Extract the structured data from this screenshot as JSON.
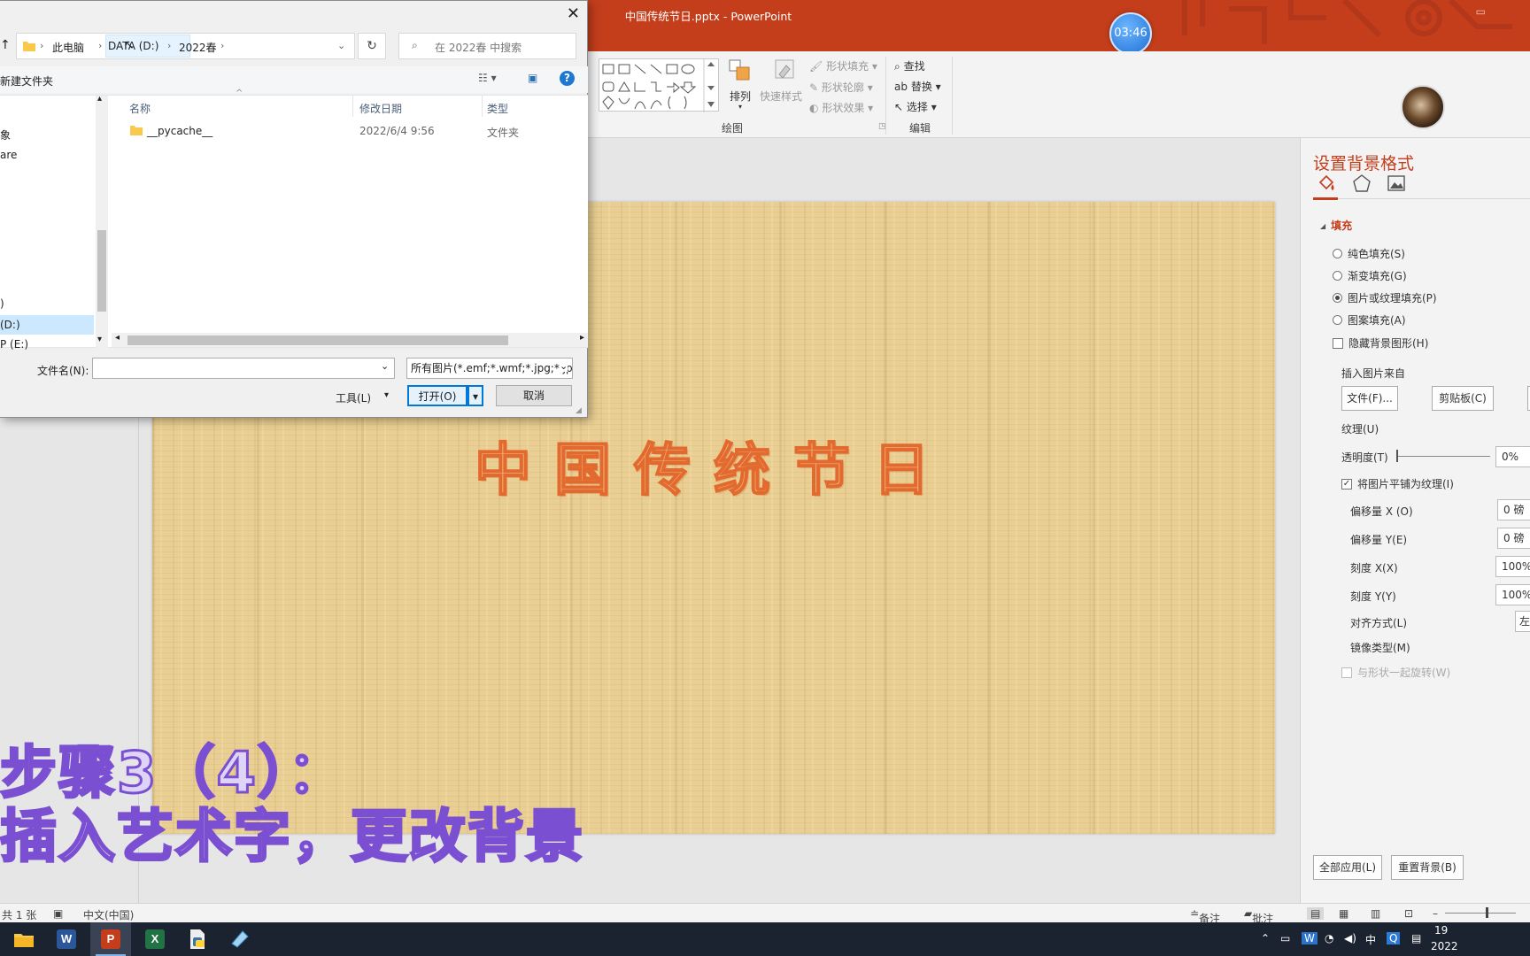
{
  "powerpoint": {
    "title": "中国传统节日.pptx - PowerPoint",
    "timer": "03:46",
    "ribbon": {
      "shape_fill": "形状填充",
      "shape_outline": "形状轮廓",
      "shape_effects": "形状效果",
      "arrange": "排列",
      "quick_styles": "快速样式",
      "group_drawing": "绘图",
      "find": "查找",
      "replace": "替换",
      "select": "选择",
      "group_editing": "编辑"
    },
    "slide": {
      "wordart": "中国传统节日"
    },
    "format_pane": {
      "title": "设置背景格式",
      "section_fill": "填充",
      "options": [
        "纯色填充(S)",
        "渐变填充(G)",
        "图片或纹理填充(P)",
        "图案填充(A)"
      ],
      "selected_option": "图片或纹理填充(P)",
      "hide_bg_graphics": "隐藏背景图形(H)",
      "insert_from": "插入图片来自",
      "file_button": "文件(F)...",
      "clipboard_button": "剪贴板(C)",
      "texture": "纹理(U)",
      "transparency_label": "透明度(T)",
      "transparency_value": "0%",
      "transparency_level": 0,
      "tile_as_texture": "将图片平铺为纹理(I)",
      "offset_x_label": "偏移量 X (O)",
      "offset_x_value": "0 磅",
      "offset_y_label": "偏移量 Y(E)",
      "offset_y_value": "0 磅",
      "scale_x_label": "刻度 X(X)",
      "scale_x_value": "100%",
      "scale_y_label": "刻度 Y(Y)",
      "scale_y_value": "100%",
      "alignment_label": "对齐方式(L)",
      "alignment_value": "左",
      "mirror_label": "镜像类型(M)",
      "rotate_with_shape": "与形状一起旋转(W)",
      "apply_all": "全部应用(L)",
      "reset_bg": "重置背景(B)"
    },
    "status": {
      "slide_count": "共 1 张",
      "language": "中文(中国)",
      "notes": "备注",
      "comments": "批注"
    }
  },
  "dialog": {
    "breadcrumb": [
      "此电脑",
      "DATA (D:)",
      "2022春"
    ],
    "search_placeholder": "在 2022春 中搜索",
    "new_folder": "新建文件夹",
    "nav_items": [
      "象",
      "are",
      ")",
      "(D:)",
      "P (E:)"
    ],
    "columns": {
      "name": "名称",
      "date": "修改日期",
      "type": "类型"
    },
    "files": [
      {
        "name": "__pycache__",
        "date": "2022/6/4 9:56",
        "type": "文件夹"
      }
    ],
    "filename_label": "文件名(N):",
    "filename_value": "",
    "filter": "所有图片(*.emf;*.wmf;*.jpg;*.jpeg",
    "tools": "工具(L)",
    "open": "打开(O)",
    "cancel": "取消"
  },
  "caption": {
    "line1": "步骤3（4）：",
    "line2": "插入艺术字，更改背景"
  },
  "taskbar": {
    "apps": [
      "file-explorer",
      "word",
      "powerpoint",
      "excel",
      "python-script",
      "notes-app"
    ],
    "ime": "中",
    "clock": "19",
    "date": "2022"
  },
  "colors": {
    "accent": "#c43e1c",
    "caption_stroke": "#7b4fd1",
    "wordart_stroke": "#e36a2e"
  }
}
